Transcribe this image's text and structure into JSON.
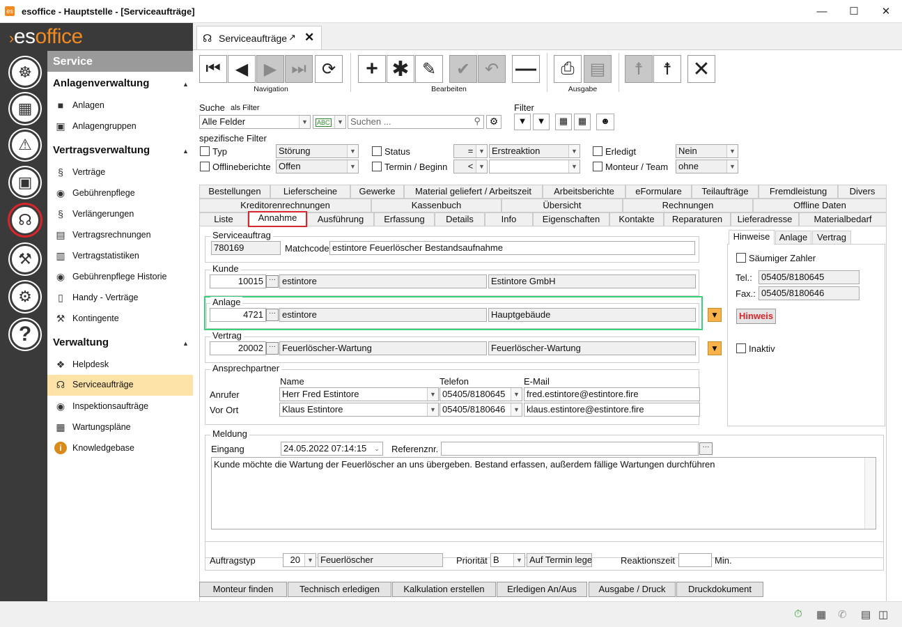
{
  "window": {
    "title": "esoffice - Hauptstelle - [Serviceaufträge]"
  },
  "logo": {
    "part1": "es",
    "part2": "office"
  },
  "sidebar": {
    "header": "Service",
    "groups": [
      {
        "title": "Anlagenverwaltung",
        "items": [
          "Anlagen",
          "Anlagengruppen"
        ]
      },
      {
        "title": "Vertragsverwaltung",
        "items": [
          "Verträge",
          "Gebührenpflege",
          "Verlängerungen",
          "Vertragsrechnungen",
          "Vertragstatistiken",
          "Gebührenpflege Historie",
          "Handy - Verträge",
          "Kontingente"
        ]
      },
      {
        "title": "Verwaltung",
        "items": [
          "Helpdesk",
          "Serviceaufträge",
          "Inspektionsaufträge",
          "Wartungspläne",
          "Knowledgebase"
        ]
      }
    ]
  },
  "doc_tab": {
    "label": "Serviceaufträge"
  },
  "toolbar": {
    "navigation": "Navigation",
    "bearbeiten": "Bearbeiten",
    "ausgabe": "Ausgabe"
  },
  "search": {
    "label": "Suche",
    "als_filter": "als Filter",
    "field": "Alle Felder",
    "placeholder": "Suchen ...",
    "filter_label": "Filter"
  },
  "specific": {
    "title": "spezifische Filter",
    "typ": "Typ",
    "typ_val": "Störung",
    "offline": "Offlineberichte",
    "offline_val": "Offen",
    "status": "Status",
    "status_op": "=",
    "status_val": "Erstreaktion",
    "termin": "Termin / Beginn",
    "termin_op": "<",
    "termin_val": "",
    "erledigt": "Erledigt",
    "erledigt_val": "Nein",
    "monteur": "Monteur / Team",
    "monteur_val": "ohne"
  },
  "tabs": {
    "row1": [
      "Bestellungen",
      "Lieferscheine",
      "Gewerke",
      "Material geliefert / Arbeitszeit",
      "Arbeitsberichte",
      "eFormulare",
      "Teilaufträge",
      "Fremdleistung",
      "Divers"
    ],
    "row2": [
      "Kreditorenrechnungen",
      "Kassenbuch",
      "Übersicht",
      "Rechnungen",
      "Offline Daten"
    ],
    "row3": [
      "Liste",
      "Annahme",
      "Ausführung",
      "Erfassung",
      "Details",
      "Info",
      "Eigenschaften",
      "Kontakte",
      "Reparaturen",
      "Lieferadresse",
      "Materialbedarf"
    ]
  },
  "form": {
    "serviceauftrag": {
      "label": "Serviceauftrag",
      "number": "780169",
      "matchcode_label": "Matchcode",
      "matchcode": "estintore Feuerlöscher Bestandsaufnahme"
    },
    "kunde": {
      "label": "Kunde",
      "number": "10015",
      "short": "estintore",
      "name": "Estintore GmbH"
    },
    "anlage": {
      "label": "Anlage",
      "number": "4721",
      "short": "estintore",
      "name": "Hauptgebäude"
    },
    "vertrag": {
      "label": "Vertrag",
      "number": "20002",
      "short": "Feuerlöscher-Wartung",
      "name": "Feuerlöscher-Wartung"
    },
    "ansprech": {
      "label": "Ansprechpartner",
      "col_name": "Name",
      "col_tel": "Telefon",
      "col_mail": "E-Mail",
      "rows": [
        {
          "role": "Anrufer",
          "name": "Herr Fred Estintore",
          "tel": "05405/8180645",
          "mail": "fred.estintore@estintore.fire"
        },
        {
          "role": "Vor Ort",
          "name": "Klaus Estintore",
          "tel": "05405/8180646",
          "mail": "klaus.estintore@estintore.fire"
        }
      ]
    },
    "meldung": {
      "label": "Meldung",
      "eingang_label": "Eingang",
      "eingang": "24.05.2022 07:14:15",
      "ref_label": "Referenznr.",
      "ref": "",
      "text": "Kunde möchte die Wartung der Feuerlöscher an uns übergeben. Bestand erfassen, außerdem fällige Wartungen durchführen"
    },
    "auftrag": {
      "typ_label": "Auftragstyp",
      "typ_num": "20",
      "typ_name": "Feuerlöscher",
      "prio_label": "Priorität",
      "prio": "B",
      "termin_btn": "Auf Termin lege",
      "reaktion_label": "Reaktionszeit",
      "reaktion": "",
      "unit": "Min."
    }
  },
  "right_panel": {
    "tabs": [
      "Hinweise",
      "Anlage",
      "Vertrag"
    ],
    "saeumig": "Säumiger Zahler",
    "tel_label": "Tel.:",
    "tel": "05405/8180645",
    "fax_label": "Fax.:",
    "fax": "05405/8180646",
    "hinweis_btn": "Hinweis",
    "inaktiv": "Inaktiv"
  },
  "bottom_buttons": [
    "Monteur finden",
    "Technisch erledigen",
    "Kalkulation erstellen",
    "Erledigen An/Aus",
    "Ausgabe / Druck",
    "Druckdokument"
  ]
}
